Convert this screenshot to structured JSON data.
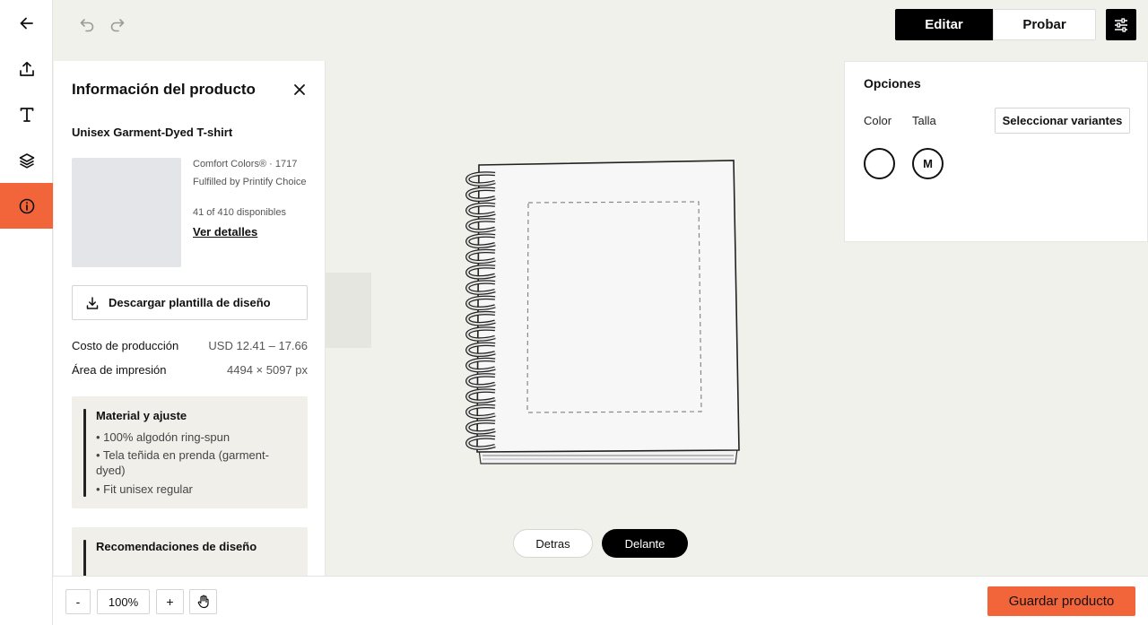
{
  "toolbar": {
    "edit_label": "Editar",
    "test_label": "Probar"
  },
  "rail": {
    "items": [
      {
        "icon": "back-arrow-icon"
      },
      {
        "icon": "upload-icon"
      },
      {
        "icon": "text-icon"
      },
      {
        "icon": "layers-icon"
      },
      {
        "icon": "info-icon",
        "active": true
      }
    ],
    "accent_color": "#f2653a"
  },
  "panel": {
    "title": "Información del producto",
    "product_name": "Unisex Garment-Dyed T-shirt",
    "brand": "Comfort Colors® · 1717",
    "fulfilled": "Fulfilled by Printify Choice",
    "availability": "41 of 410 disponibles",
    "details_link": "Ver detalles",
    "download_label": "Descargar plantilla de diseño",
    "specs": [
      {
        "label": "Costo de producción",
        "value": "USD 12.41 – 17.66"
      },
      {
        "label": "Área de impresión",
        "value": "4494 × 5097 px"
      }
    ],
    "material_card": {
      "title": "Material y ajuste",
      "items": [
        "• 100% algodón ring-spun",
        "• Tela teñida en prenda (garment-dyed)",
        "• Fit unisex regular"
      ]
    },
    "design_card": {
      "title": "Recomendaciones de diseño"
    }
  },
  "canvas": {
    "back_label": "Detras",
    "front_label": "Delante"
  },
  "options": {
    "title": "Opciones",
    "color_label": "Color",
    "size_label": "Talla",
    "variants_button": "Seleccionar variantes",
    "size_value": "M"
  },
  "bottom": {
    "zoom_out": "-",
    "zoom_value": "100%",
    "zoom_in": "+",
    "save_label": "Guardar producto"
  }
}
